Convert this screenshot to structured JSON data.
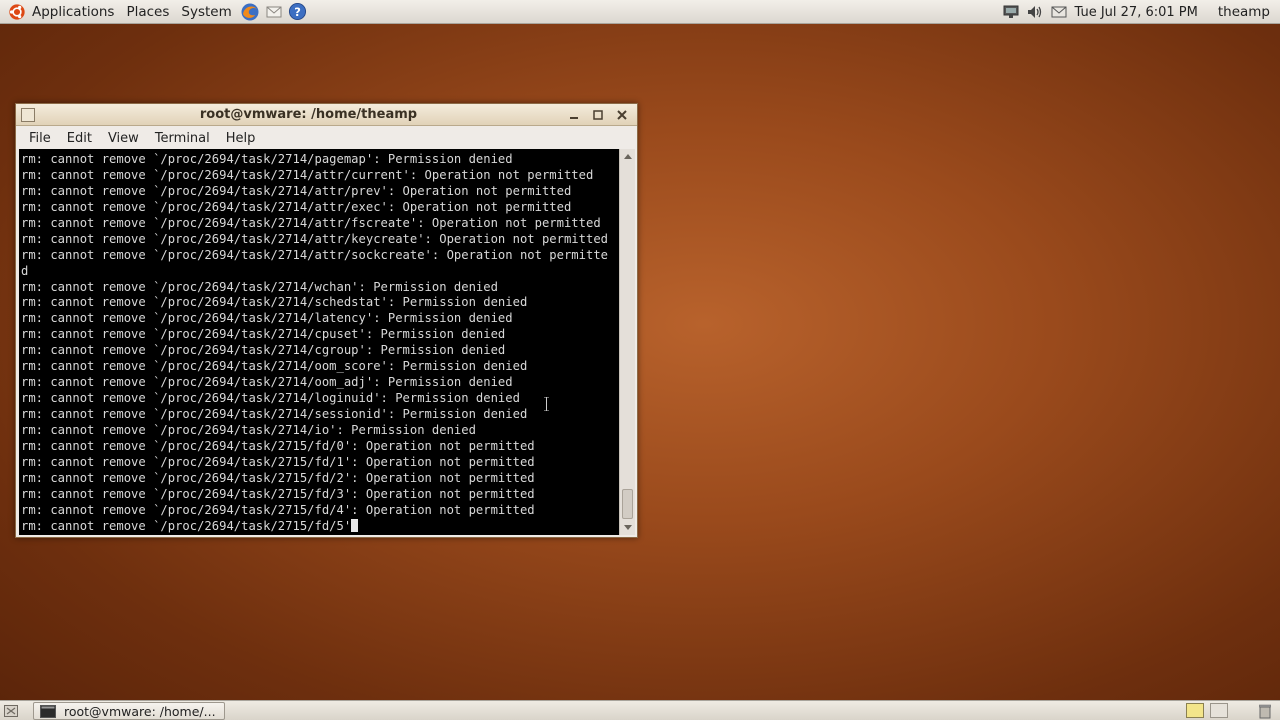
{
  "top_panel": {
    "menus": [
      "Applications",
      "Places",
      "System"
    ],
    "launchers": [
      "firefox-icon",
      "mail-icon",
      "help-icon"
    ],
    "clock": "Tue Jul 27,  6:01 PM",
    "username": "theamp"
  },
  "window": {
    "title": "root@vmware: /home/theamp",
    "menu": [
      "File",
      "Edit",
      "View",
      "Terminal",
      "Help"
    ],
    "terminal_lines": [
      "rm: cannot remove `/proc/2694/task/2714/pagemap': Permission denied",
      "rm: cannot remove `/proc/2694/task/2714/attr/current': Operation not permitted",
      "rm: cannot remove `/proc/2694/task/2714/attr/prev': Operation not permitted",
      "rm: cannot remove `/proc/2694/task/2714/attr/exec': Operation not permitted",
      "rm: cannot remove `/proc/2694/task/2714/attr/fscreate': Operation not permitted",
      "rm: cannot remove `/proc/2694/task/2714/attr/keycreate': Operation not permitted",
      "rm: cannot remove `/proc/2694/task/2714/attr/sockcreate': Operation not permitte",
      "d",
      "rm: cannot remove `/proc/2694/task/2714/wchan': Permission denied",
      "rm: cannot remove `/proc/2694/task/2714/schedstat': Permission denied",
      "rm: cannot remove `/proc/2694/task/2714/latency': Permission denied",
      "rm: cannot remove `/proc/2694/task/2714/cpuset': Permission denied",
      "rm: cannot remove `/proc/2694/task/2714/cgroup': Permission denied",
      "rm: cannot remove `/proc/2694/task/2714/oom_score': Permission denied",
      "rm: cannot remove `/proc/2694/task/2714/oom_adj': Permission denied",
      "rm: cannot remove `/proc/2694/task/2714/loginuid': Permission denied",
      "rm: cannot remove `/proc/2694/task/2714/sessionid': Permission denied",
      "rm: cannot remove `/proc/2694/task/2714/io': Permission denied",
      "rm: cannot remove `/proc/2694/task/2715/fd/0': Operation not permitted",
      "rm: cannot remove `/proc/2694/task/2715/fd/1': Operation not permitted",
      "rm: cannot remove `/proc/2694/task/2715/fd/2': Operation not permitted",
      "rm: cannot remove `/proc/2694/task/2715/fd/3': Operation not permitted",
      "rm: cannot remove `/proc/2694/task/2715/fd/4': Operation not permitted"
    ],
    "last_line": "rm: cannot remove `/proc/2694/task/2715/fd/5'"
  },
  "bottom_panel": {
    "task_label": "root@vmware: /home/..."
  },
  "colors": {
    "desktop": "#9a4a1c",
    "terminal_bg": "#000000",
    "terminal_fg": "#d8d8d8"
  }
}
